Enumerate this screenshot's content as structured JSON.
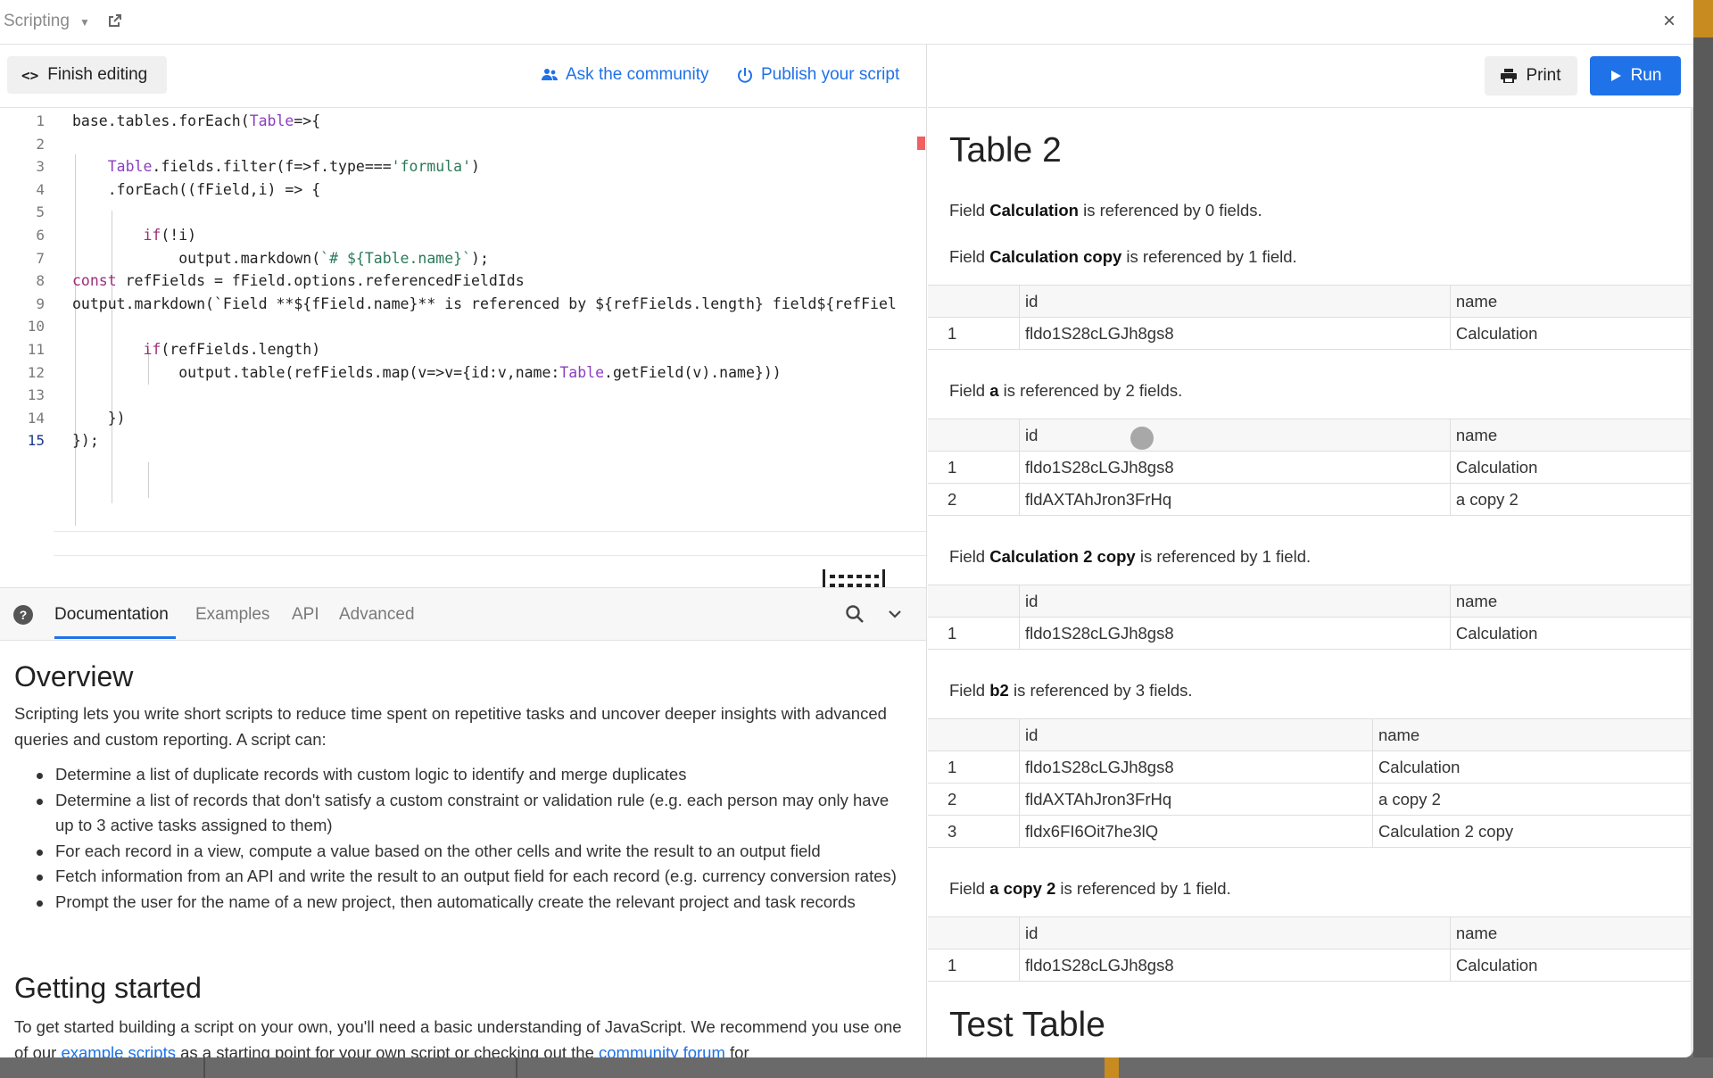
{
  "window": {
    "title": "Scripting",
    "close_label": "×"
  },
  "editor_toolbar": {
    "finish_label": "Finish editing",
    "community_label": "Ask the community",
    "publish_label": "Publish your script"
  },
  "code_lines": [
    "base.tables.forEach(Table=>{",
    "",
    "    Table.fields.filter(f=>f.type==='formula')",
    "    .forEach((fField,i) => {",
    "",
    "        if(!i)",
    "            output.markdown(`# ${Table.name}`);",
    "const refFields = fField.options.referencedFieldIds",
    "output.markdown(`Field **${fField.name}** is referenced by ${refFields.length} field${refFiel",
    "",
    "        if(refFields.length)",
    "            output.table(refFields.map(v=>v={id:v,name:Table.getField(v).name}))",
    "",
    "    })",
    "});"
  ],
  "line_numbers": [
    "1",
    "2",
    "3",
    "4",
    "5",
    "6",
    "7",
    "8",
    "9",
    "10",
    "11",
    "12",
    "13",
    "14",
    "15"
  ],
  "doc_tabs": [
    "Documentation",
    "Examples",
    "API",
    "Advanced"
  ],
  "doc": {
    "overview_title": "Overview",
    "overview_text": "Scripting lets you write short scripts to reduce time spent on repetitive tasks and uncover deeper insights with advanced queries and custom reporting. A script can:",
    "bullets": [
      "Determine a list of duplicate records with custom logic to identify and merge duplicates",
      "Determine a list of records that don't satisfy a custom constraint or validation rule (e.g. each person may only have up to 3 active tasks assigned to them)",
      "For each record in a view, compute a value based on the other cells and write the result to an output field",
      "Fetch information from an API and write the result to an output field for each record (e.g. currency conversion rates)",
      "Prompt the user for the name of a new project, then automatically create the relevant project and task records"
    ],
    "getting_started_title": "Getting started",
    "getting_started_text_a": "To get started building a script on your own, you'll need a basic understanding of JavaScript. We recommend you use one of our ",
    "link_examples": "example scripts",
    "getting_started_text_b": " as a starting point for your own script or checking out the ",
    "link_forum": "community forum",
    "getting_started_text_c": " for"
  },
  "output_toolbar": {
    "print_label": "Print",
    "run_label": "Run"
  },
  "output": {
    "table_heading": "Table 2",
    "col_id": "id",
    "col_name": "name",
    "fields": [
      {
        "prefix": "Field ",
        "name": "Calculation",
        "suffix": " is referenced by 0 fields.",
        "rows": []
      },
      {
        "prefix": "Field ",
        "name": "Calculation copy",
        "suffix": " is referenced by 1 field.",
        "rows": [
          {
            "n": "1",
            "id": "fldo1S28cLGJh8gs8",
            "name": "Calculation"
          }
        ]
      },
      {
        "prefix": "Field ",
        "name": "a",
        "suffix": " is referenced by 2 fields.",
        "rows": [
          {
            "n": "1",
            "id": "fldo1S28cLGJh8gs8",
            "name": "Calculation"
          },
          {
            "n": "2",
            "id": "fldAXTAhJron3FrHq",
            "name": "a copy 2"
          }
        ]
      },
      {
        "prefix": "Field ",
        "name": "Calculation 2 copy",
        "suffix": " is referenced by 1 field.",
        "rows": [
          {
            "n": "1",
            "id": "fldo1S28cLGJh8gs8",
            "name": "Calculation"
          }
        ]
      },
      {
        "prefix": "Field ",
        "name": "b2",
        "suffix": " is referenced by 3 fields.",
        "rows": [
          {
            "n": "1",
            "id": "fldo1S28cLGJh8gs8",
            "name": "Calculation"
          },
          {
            "n": "2",
            "id": "fldAXTAhJron3FrHq",
            "name": "a copy 2"
          },
          {
            "n": "3",
            "id": "fldx6FI6Oit7he3lQ",
            "name": "Calculation 2 copy"
          }
        ]
      },
      {
        "prefix": "Field ",
        "name": "a copy 2",
        "suffix": " is referenced by 1 field.",
        "rows": [
          {
            "n": "1",
            "id": "fldo1S28cLGJh8gs8",
            "name": "Calculation"
          }
        ]
      }
    ],
    "next_table_heading": "Test Table"
  },
  "colors": {
    "accent": "#1f72e8",
    "error_marker": "#f06060",
    "background_app": "#c78b20"
  }
}
